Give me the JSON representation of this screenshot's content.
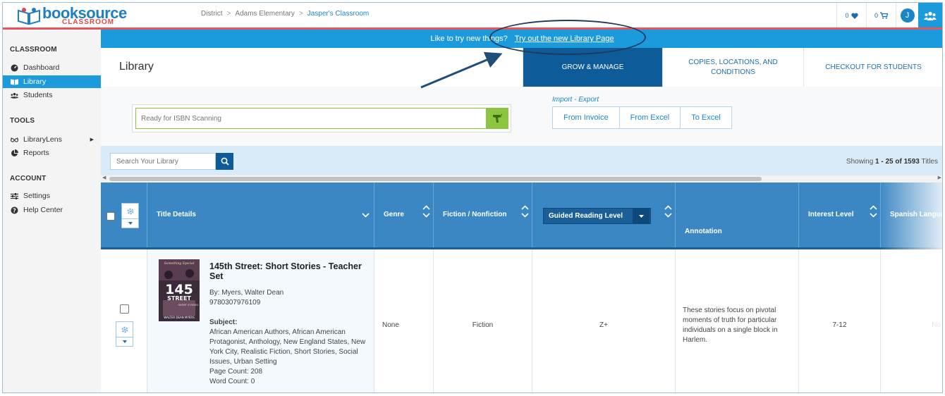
{
  "brand": {
    "name": "booksource",
    "sub": "CLASSROOM"
  },
  "breadcrumb": [
    "District",
    "Adams Elementary",
    "Jasper's Classroom"
  ],
  "topbar": {
    "favorites_count": "0",
    "cart_count": "0",
    "avatar_initial": "J"
  },
  "sidebar": {
    "sections": [
      {
        "heading": "CLASSROOM",
        "items": [
          {
            "label": "Dashboard",
            "icon": "dashboard-icon"
          },
          {
            "label": "Library",
            "icon": "book-open-icon",
            "active": true
          },
          {
            "label": "Students",
            "icon": "users-icon"
          }
        ]
      },
      {
        "heading": "TOOLS",
        "items": [
          {
            "label": "LibraryLens",
            "icon": "glasses-icon"
          },
          {
            "label": "Reports",
            "icon": "pie-chart-icon"
          }
        ]
      },
      {
        "heading": "ACCOUNT",
        "items": [
          {
            "label": "Settings",
            "icon": "sliders-icon"
          },
          {
            "label": "Help Center",
            "icon": "help-icon"
          }
        ]
      }
    ]
  },
  "banner": {
    "prompt": "Like to try new things?",
    "link": "Try out the new Library Page"
  },
  "library": {
    "title": "Library",
    "tabs": [
      "GROW & MANAGE",
      "COPIES, LOCATIONS, AND CONDITIONS",
      "CHECKOUT FOR STUDENTS"
    ]
  },
  "scan": {
    "placeholder": "Ready for ISBN Scanning"
  },
  "import_export": {
    "label": "Import - Export",
    "buttons": [
      "From Invoice",
      "From Excel",
      "To Excel"
    ]
  },
  "search": {
    "placeholder": "Search Your Library"
  },
  "showing": {
    "prefix": "Showing",
    "range": "1 - 25 of 1593",
    "suffix": "Titles"
  },
  "columns": {
    "title": "Title Details",
    "genre": "Genre",
    "fiction": "Fiction / Nonfiction",
    "guided": "Guided Reading Level",
    "annotation": "Annotation",
    "interest": "Interest Level",
    "spanish": "Spanish Language"
  },
  "rows": [
    {
      "title": "145th Street: Short Stories - Teacher Set",
      "author": "By: Myers, Walter Dean",
      "isbn": "9780307976109",
      "subject_label": "Subject:",
      "subjects": "African American Authors, African American Protagonist, Anthology, New England States, New York City, Realistic Fiction, Short Stories, Social Issues, Urban Setting",
      "page_count": "Page Count: 208",
      "word_count": "Word Count: 0",
      "genre": "None",
      "fiction": "Fiction",
      "guided_level": "Z+",
      "annotation": "These stories focus on pivotal moments of truth for particular individuals on a single block in Harlem.",
      "interest_level": "7-12",
      "spanish": "No",
      "cover": {
        "top_text": "Something Special",
        "number": "145",
        "word": "STREET",
        "sub": "SHORT STORIES",
        "author": "WALTER DEAN MYERS"
      }
    }
  ]
}
